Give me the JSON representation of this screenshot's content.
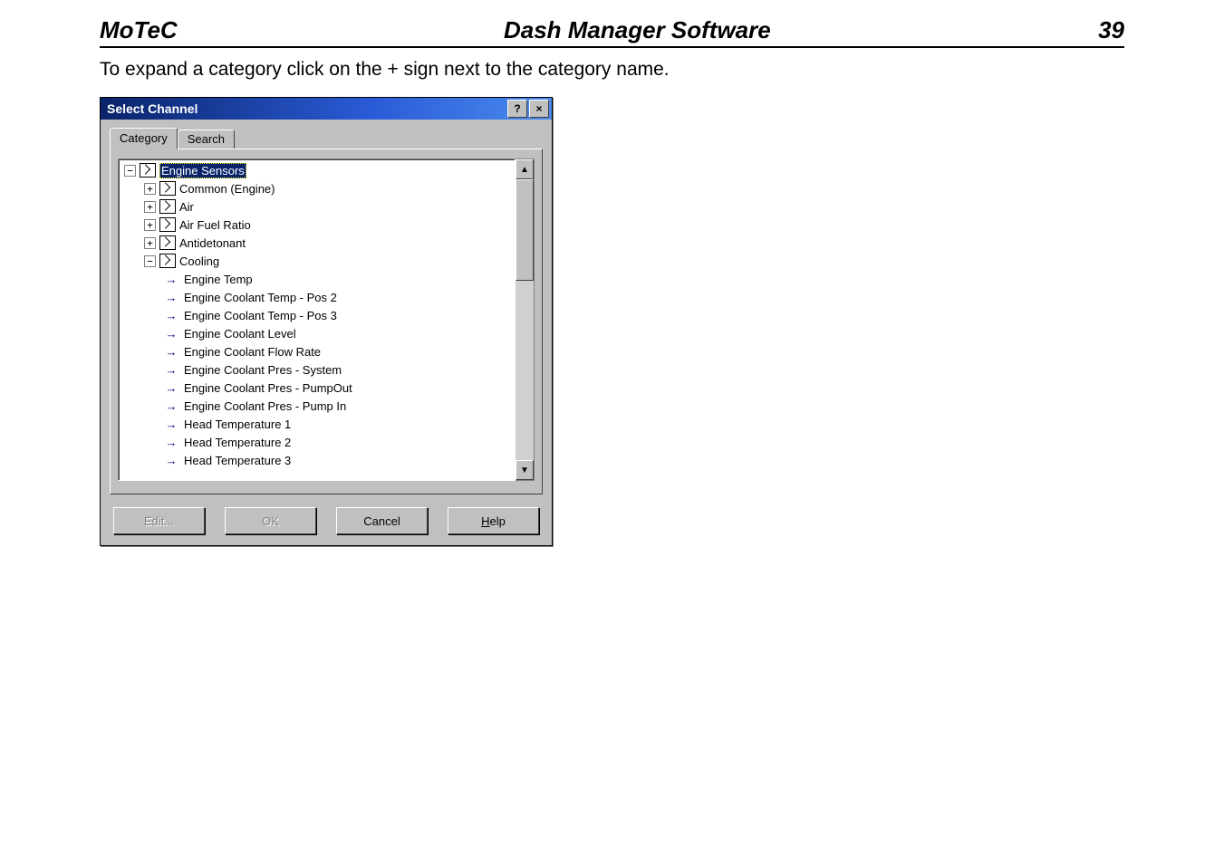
{
  "header": {
    "brand": "MoTeC",
    "title": "Dash Manager Software",
    "page_number": "39"
  },
  "intro_text": "To expand a category click on the + sign next to the category name.",
  "dialog": {
    "title": "Select Channel",
    "help_btn": "?",
    "close_btn": "×",
    "tabs": {
      "category": "Category",
      "search": "Search"
    },
    "tree": {
      "root": {
        "label": "Engine Sensors",
        "exp": "−"
      },
      "lvl1": [
        {
          "label": "Common (Engine)",
          "exp": "+"
        },
        {
          "label": "Air",
          "exp": "+"
        },
        {
          "label": "Air Fuel Ratio",
          "exp": "+"
        },
        {
          "label": "Antidetonant",
          "exp": "+"
        },
        {
          "label": "Cooling",
          "exp": "−"
        }
      ],
      "cooling_items": [
        "Engine Temp",
        "Engine Coolant Temp - Pos 2",
        "Engine Coolant Temp - Pos 3",
        "Engine Coolant Level",
        "Engine Coolant Flow Rate",
        "Engine Coolant Pres - System",
        "Engine Coolant Pres - PumpOut",
        "Engine Coolant Pres - Pump In",
        "Head Temperature 1",
        "Head Temperature 2",
        "Head Temperature 3"
      ]
    },
    "buttons": {
      "edit": "Edit...",
      "ok": "OK",
      "cancel": "Cancel",
      "help_prefix": "H",
      "help_rest": "elp"
    }
  }
}
